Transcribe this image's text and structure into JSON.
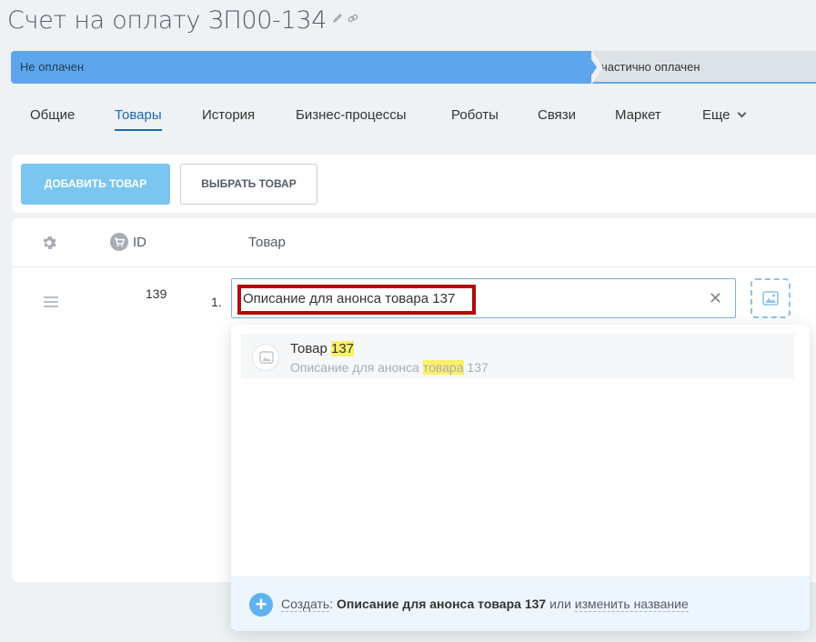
{
  "page": {
    "title": "Счет на оплату ЗП00-134",
    "edit_icon": "pencil-icon",
    "link_icon": "link-icon"
  },
  "stages": {
    "current": "Не оплачен",
    "next": "частично оплачен",
    "current_color": "#5ea6ec",
    "next_color": "#dde2e6"
  },
  "tabs": [
    {
      "label": "Общие"
    },
    {
      "label": "Товары"
    },
    {
      "label": "История"
    },
    {
      "label": "Бизнес-процессы"
    },
    {
      "label": "Роботы"
    },
    {
      "label": "Связи"
    },
    {
      "label": "Маркет"
    },
    {
      "label": "Еще"
    }
  ],
  "toolbar": {
    "add_label": "ДОБАВИТЬ ТОВАР",
    "select_label": "ВЫБРАТЬ ТОВАР"
  },
  "table": {
    "header_id": "ID",
    "header_product": "Товар",
    "row": {
      "id": "139",
      "number": "1.",
      "input_value": "Описание для анонса товара 137",
      "clear_symbol": "✕"
    }
  },
  "dropdown": {
    "suggestion": {
      "title_prefix": "Товар ",
      "title_match": "137",
      "sub_prefix": "Описание для анонса ",
      "sub_match": "товара",
      "sub_suffix": " 137"
    },
    "footer": {
      "plus": "+",
      "create_label": "Создать",
      "colon": ": ",
      "create_value": "Описание для анонса товара 137",
      "or": " или ",
      "rename_label": "изменить название"
    }
  }
}
